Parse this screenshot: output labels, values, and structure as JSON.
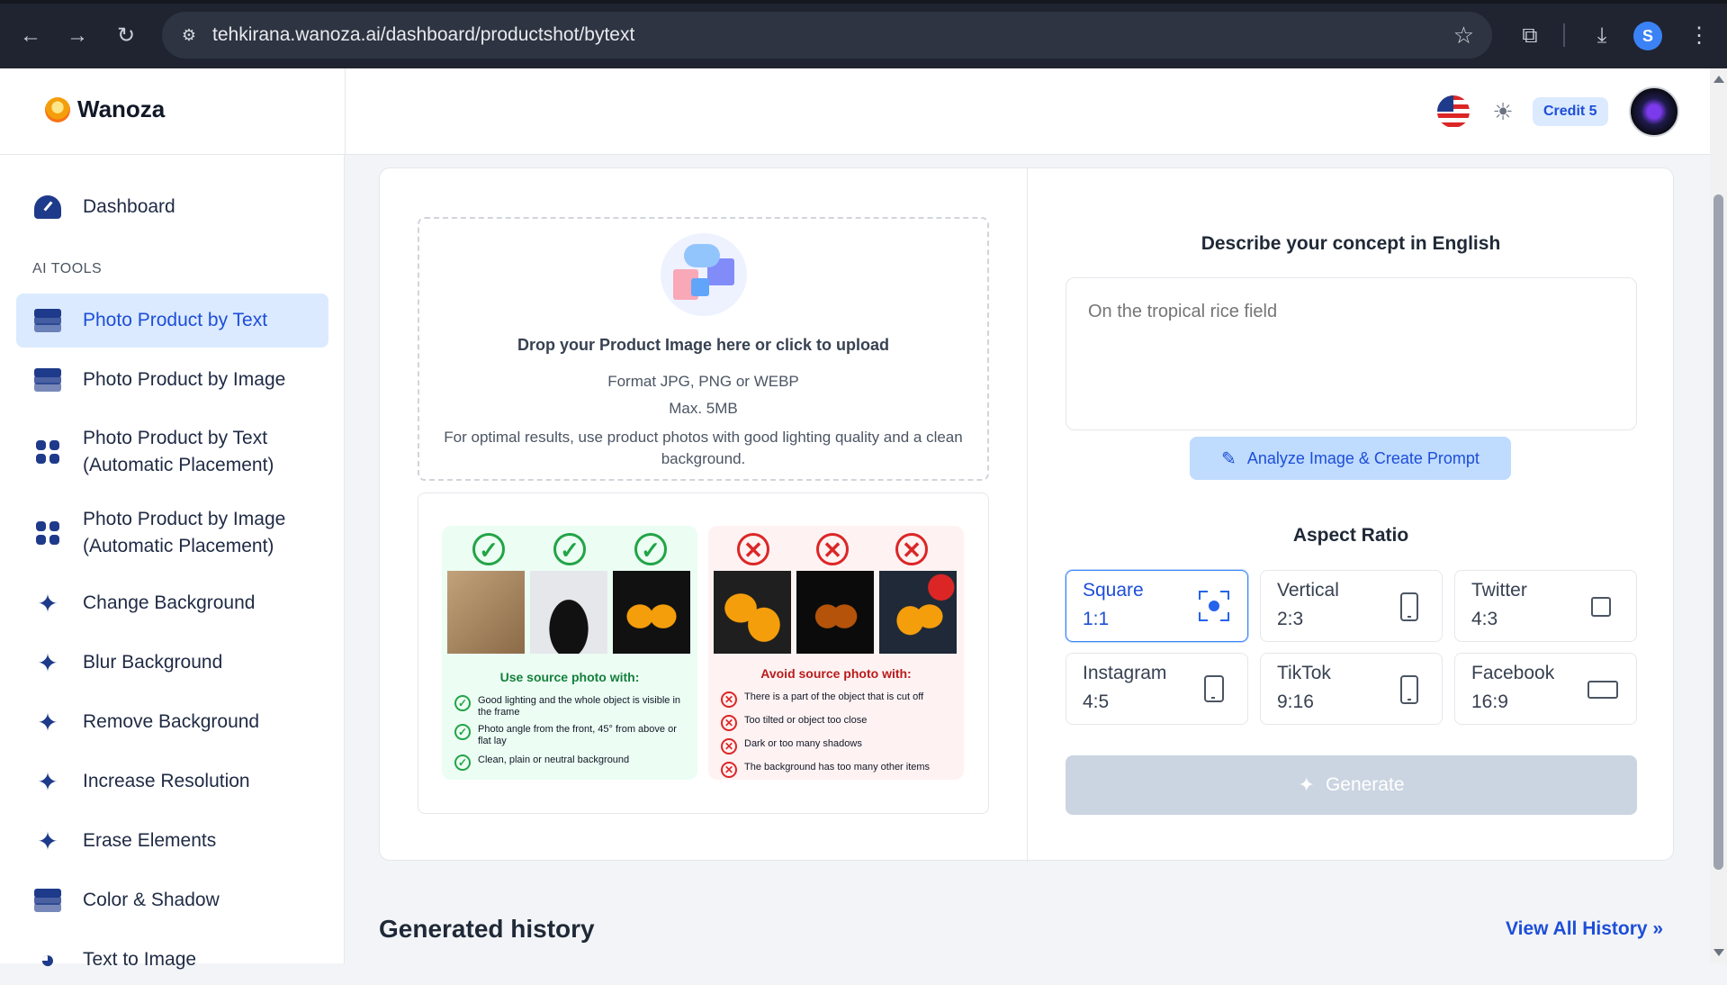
{
  "browser": {
    "url": "tehkirana.wanoza.ai/dashboard/productshot/bytext"
  },
  "header": {
    "brand": "Wanoza",
    "credit": "Credit 5"
  },
  "sidebar": {
    "dashboard": "Dashboard",
    "section_label": "AI TOOLS",
    "items": [
      {
        "label": "Photo Product by Text",
        "icon": "layers-icon",
        "active": true
      },
      {
        "label": "Photo Product by Image",
        "icon": "layers-icon"
      },
      {
        "label": "Photo Product by Text\n(Automatic Placement)",
        "icon": "grid-icon"
      },
      {
        "label": "Photo Product by Image\n(Automatic Placement)",
        "icon": "grid-icon"
      },
      {
        "label": "Change Background",
        "icon": "sparkles-icon"
      },
      {
        "label": "Blur Background",
        "icon": "sparkles-icon"
      },
      {
        "label": "Remove Background",
        "icon": "sparkles-icon"
      },
      {
        "label": "Increase Resolution",
        "icon": "sparkles-icon"
      },
      {
        "label": "Erase Elements",
        "icon": "sparkles-icon"
      },
      {
        "label": "Color & Shadow",
        "icon": "layers-icon"
      },
      {
        "label": "Text to Image",
        "icon": "palette-icon"
      }
    ]
  },
  "upload": {
    "title": "Drop your Product Image here or click to upload",
    "format": "Format JPG, PNG or WEBP",
    "max": "Max. 5MB",
    "tip": "For optimal results, use product photos with good lighting quality and a clean background."
  },
  "examples": {
    "good_title": "Use source photo with:",
    "good_rules": [
      "Good lighting and the whole object is visible in the frame",
      "Photo angle from the front, 45° from above or flat lay",
      "Clean, plain or neutral background"
    ],
    "bad_title": "Avoid source photo with:",
    "bad_rules": [
      "There is a part of the object that is cut off",
      "Too tilted or object too close",
      "Dark or too many shadows",
      "The background has too many other items"
    ]
  },
  "concept": {
    "title": "Describe your concept in English",
    "placeholder": "On the tropical rice field",
    "analyze_label": "Analyze Image & Create Prompt"
  },
  "aspect": {
    "title": "Aspect Ratio",
    "options": [
      {
        "name": "Square",
        "ratio": "1:1",
        "selected": true
      },
      {
        "name": "Vertical",
        "ratio": "2:3"
      },
      {
        "name": "Twitter",
        "ratio": "4:3"
      },
      {
        "name": "Instagram",
        "ratio": "4:5"
      },
      {
        "name": "TikTok",
        "ratio": "9:16"
      },
      {
        "name": "Facebook",
        "ratio": "16:9"
      }
    ]
  },
  "generate_label": "Generate",
  "history": {
    "title": "Generated history",
    "view_all": "View All History"
  }
}
